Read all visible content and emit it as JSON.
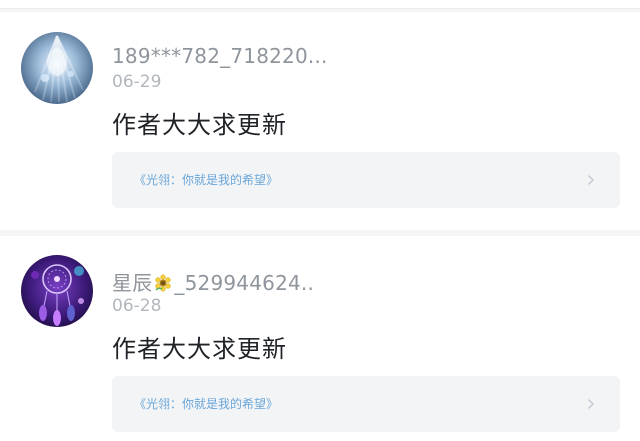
{
  "comments": [
    {
      "username": "189***782_718220...",
      "date": "06-29",
      "content": "作者大大求更新",
      "book_title": "《光翎：你就是我的希望》",
      "avatar": "avatar-icon"
    },
    {
      "username_prefix": "星辰",
      "username_suffix": "_529944624..",
      "username_emoji": "sunflower-icon",
      "date": "06-28",
      "content": "作者大大求更新",
      "book_title": "《光翎：你就是我的希望》",
      "avatar": "avatar-icon"
    }
  ],
  "colors": {
    "username": "#8f959c",
    "date": "#b2b7bd",
    "content": "#1f2226",
    "link": "#6aa6d9",
    "card_bg": "#f3f4f6",
    "page_bg": "#f4f5f7"
  },
  "icons": {
    "chevron": "chevron-right-icon"
  }
}
